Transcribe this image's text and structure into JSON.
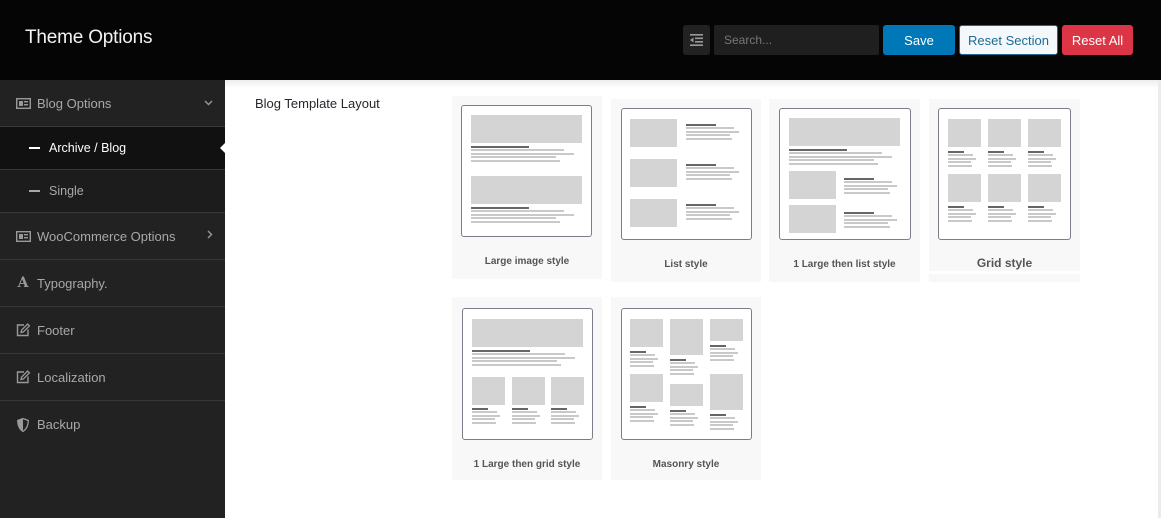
{
  "header": {
    "title": "Theme Options",
    "search_placeholder": "Search...",
    "save_label": "Save",
    "reset_section_label": "Reset Section",
    "reset_all_label": "Reset All"
  },
  "colors": {
    "save": "#0077b6",
    "reset_section_border": "#1d6b94",
    "reset_all": "#dc3545",
    "sidebar_bg": "#222222",
    "header_bg": "#050505"
  },
  "sidebar": {
    "items": [
      {
        "label": "Blog Options",
        "icon": "newspaper-icon",
        "chevron": "chevron-down-icon",
        "expanded": true
      },
      {
        "label": "WooCommerce Options",
        "icon": "newspaper-icon",
        "chevron": "chevron-right-icon"
      },
      {
        "label": "Typography.",
        "icon": "font-icon"
      },
      {
        "label": "Footer",
        "icon": "edit-icon"
      },
      {
        "label": "Localization",
        "icon": "edit-icon"
      },
      {
        "label": "Backup",
        "icon": "shield-icon"
      }
    ],
    "subitems": [
      {
        "label": "Archive / Blog",
        "active": true
      },
      {
        "label": "Single",
        "active": false
      }
    ]
  },
  "main": {
    "field_label": "Blog Template Layout",
    "options": [
      {
        "label": "Large image style",
        "layout": "large"
      },
      {
        "label": "List style",
        "layout": "list"
      },
      {
        "label": "1 Large then list style",
        "layout": "large-list"
      },
      {
        "label": "Grid style",
        "layout": "grid",
        "selected": true
      },
      {
        "label": "1 Large then grid style",
        "layout": "large-grid"
      },
      {
        "label": "Masonry style",
        "layout": "masonry"
      }
    ]
  }
}
